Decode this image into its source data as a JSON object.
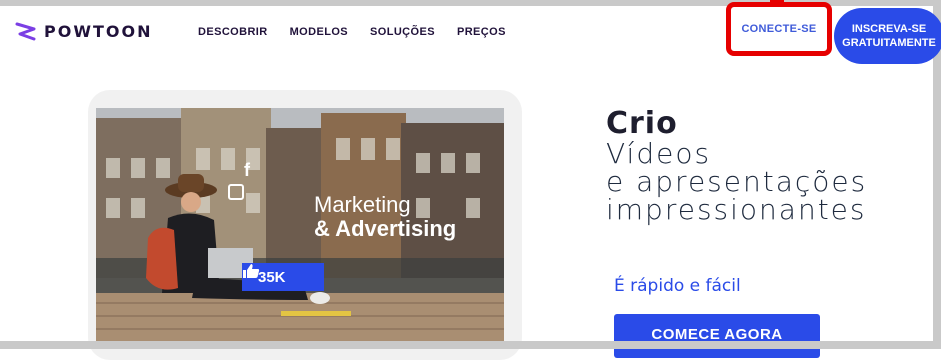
{
  "brand": {
    "logo_text": "POWTOON",
    "logo_icon": "powtoon-logo-icon",
    "accent_color": "#2a4be8",
    "highlight_color": "#e60000"
  },
  "nav": {
    "items": [
      "DESCOBRIR",
      "MODELOS",
      "SOLUÇÕES",
      "PREÇOS"
    ]
  },
  "auth": {
    "login_label": "CONECTE-SE",
    "signup_line1": "INSCREVA-SE",
    "signup_line2": "GRATUITAMENTE"
  },
  "hero": {
    "image_line1": "Marketing",
    "image_line2": "& Advertising",
    "likes": "35K",
    "icons": [
      "facebook-icon",
      "instagram-icon",
      "thumbs-up-icon"
    ]
  },
  "headline": {
    "line1": "Crio",
    "line2": "Vídeos",
    "line3": "e apresentações",
    "line4": "impressionantes"
  },
  "subline": "É rápido e fácil",
  "cta_label": "COMECE AGORA"
}
